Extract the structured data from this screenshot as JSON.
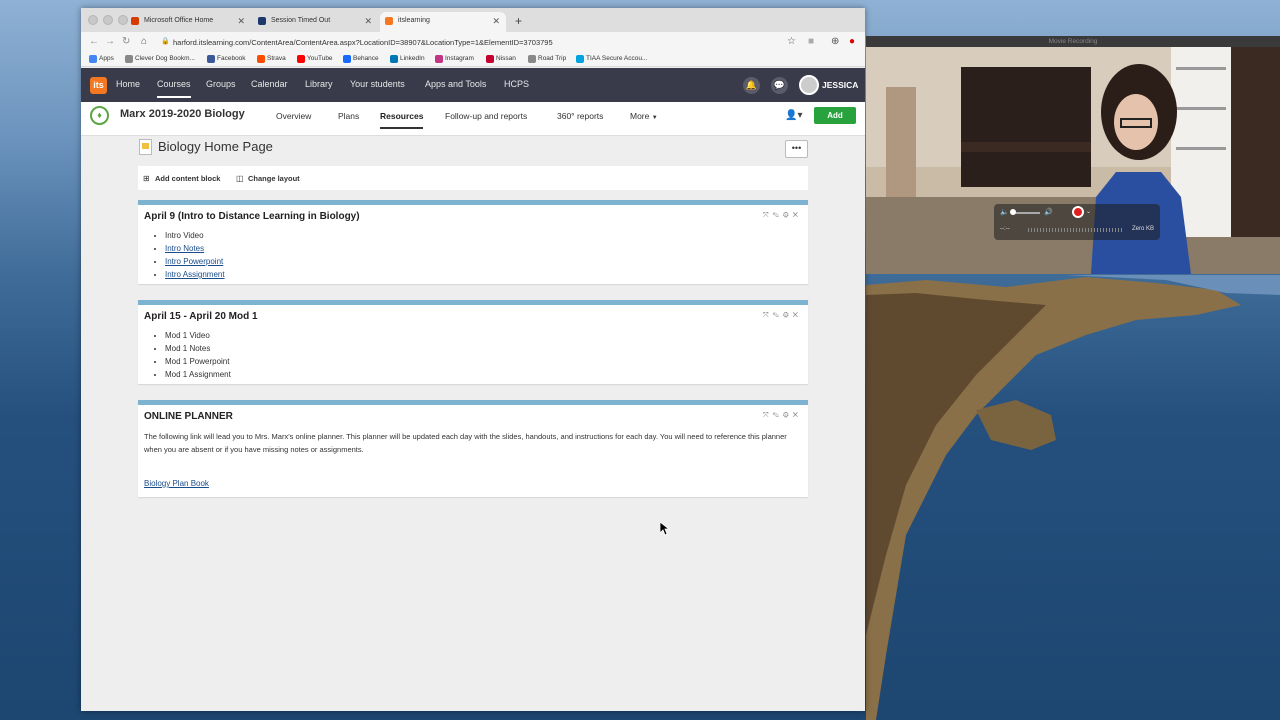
{
  "tabs": [
    {
      "title": "Microsoft Office Home",
      "color": "#d83b01"
    },
    {
      "title": "Session Timed Out",
      "color": "#1b3a6b"
    },
    {
      "title": "itslearning",
      "color": "#f47721"
    }
  ],
  "url": "harford.itslearning.com/ContentArea/ContentArea.aspx?LocationID=38907&LocationType=1&ElementID=3703795",
  "bookmarks": [
    {
      "label": "Apps",
      "color": "#4285f4"
    },
    {
      "label": "Clever Dog Bookm...",
      "color": "#888888"
    },
    {
      "label": "Facebook",
      "color": "#3b5998"
    },
    {
      "label": "Strava",
      "color": "#fc4c02"
    },
    {
      "label": "YouTube",
      "color": "#ff0000"
    },
    {
      "label": "Behance",
      "color": "#1769ff"
    },
    {
      "label": "LinkedIn",
      "color": "#0077b5"
    },
    {
      "label": "Instagram",
      "color": "#c13584"
    },
    {
      "label": "Nissan",
      "color": "#c3002f"
    },
    {
      "label": "Road Trip",
      "color": "#888888"
    },
    {
      "label": "TIAA Secure Accou...",
      "color": "#00a3e0"
    }
  ],
  "topnav": {
    "logo": "its",
    "items": [
      "Home",
      "Courses",
      "Groups",
      "Calendar",
      "Library",
      "Your students",
      "Apps and Tools",
      "HCPS"
    ],
    "user": "JESSICA"
  },
  "course": {
    "title": "Marx 2019-2020 Biology",
    "nav": [
      "Overview",
      "Plans",
      "Resources",
      "Follow-up and reports",
      "360° reports",
      "More"
    ],
    "add_label": "Add"
  },
  "page": {
    "title": "Biology Home Page",
    "more_label": "•••",
    "add_block_label": "Add content block",
    "change_layout_label": "Change layout"
  },
  "blocks": [
    {
      "title": "April 9 (Intro to Distance Learning in Biology)",
      "items": [
        {
          "label": "Intro Video",
          "link": false
        },
        {
          "label": "Intro Notes",
          "link": true
        },
        {
          "label": "Intro Powerpoint",
          "link": true
        },
        {
          "label": "Intro Assignment",
          "link": true
        }
      ]
    },
    {
      "title": "April 15 - April 20 Mod 1",
      "items": [
        {
          "label": "Mod 1 Video",
          "link": false
        },
        {
          "label": "Mod 1 Notes",
          "link": false
        },
        {
          "label": "Mod 1 Powerpoint",
          "link": false
        },
        {
          "label": "Mod 1 Assignment",
          "link": false
        }
      ]
    },
    {
      "title": "ONLINE PLANNER",
      "text": "The following link will lead you to Mrs. Marx's online planner. This planner will be updated each day with the slides, handouts, and instructions for each day. You will need to reference this planner when you are absent or if you have missing notes or assignments.",
      "link": "Biology Plan Book"
    }
  ],
  "video": {
    "window_title": "Movie Recording",
    "time": "--:--",
    "size": "Zero KB"
  }
}
